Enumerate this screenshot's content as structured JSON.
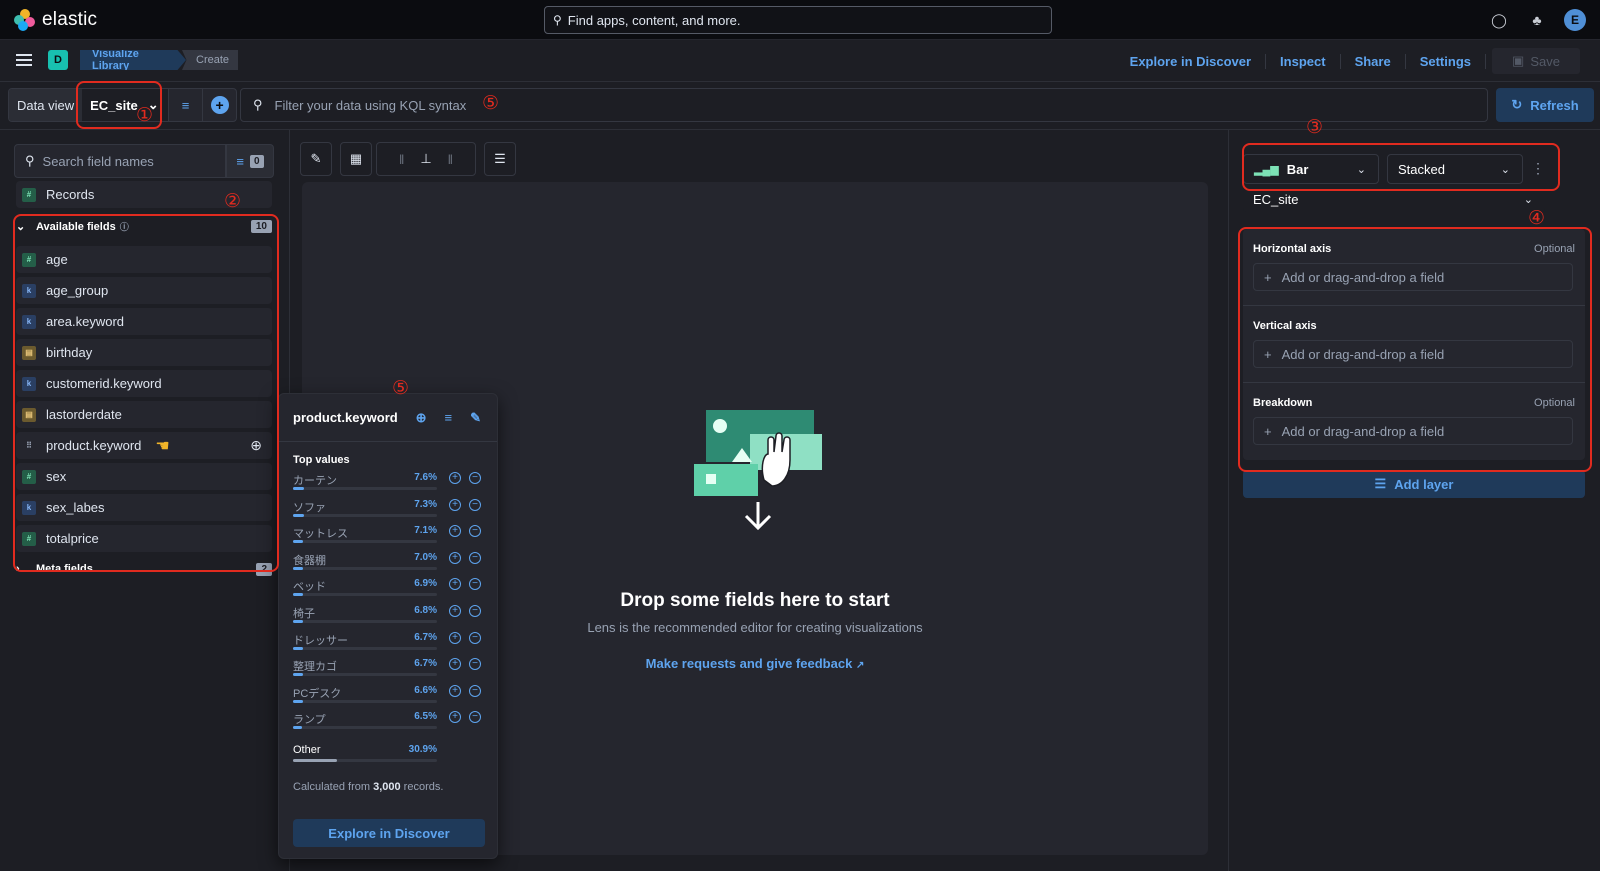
{
  "topbar": {
    "logo_text": "elastic",
    "search_placeholder": "Find apps, content, and more.",
    "avatar_initial": "E"
  },
  "navbar": {
    "space_initial": "D",
    "breadcrumbs": [
      "Visualize Library",
      "Create"
    ],
    "links": [
      "Explore in Discover",
      "Inspect",
      "Share",
      "Settings"
    ],
    "save_label": "Save"
  },
  "querybar": {
    "data_view_label": "Data view",
    "data_view_value": "EC_site",
    "kql_placeholder": "Filter your data using KQL syntax",
    "refresh_label": "Refresh"
  },
  "sidebar": {
    "search_placeholder": "Search field names",
    "filter_count": "0",
    "records_label": "Records",
    "available_label": "Available fields",
    "available_count": "10",
    "fields": [
      {
        "name": "age",
        "type": "number"
      },
      {
        "name": "age_group",
        "type": "keyword"
      },
      {
        "name": "area.keyword",
        "type": "keyword"
      },
      {
        "name": "birthday",
        "type": "date"
      },
      {
        "name": "customerid.keyword",
        "type": "keyword"
      },
      {
        "name": "lastorderdate",
        "type": "date"
      },
      {
        "name": "product.keyword",
        "type": "keyword"
      },
      {
        "name": "sex",
        "type": "number"
      },
      {
        "name": "sex_labes",
        "type": "keyword"
      },
      {
        "name": "totalprice",
        "type": "number"
      }
    ],
    "meta_label": "Meta fields",
    "meta_count": "2"
  },
  "annotations": [
    "①",
    "②",
    "③",
    "④",
    "⑤",
    "⑤"
  ],
  "workspace": {
    "drop_title": "Drop some fields here to start",
    "drop_subtitle": "Lens is the recommended editor for creating visualizations",
    "feedback_link": "Make requests and give feedback"
  },
  "popover": {
    "field_name": "product.keyword",
    "top_values_title": "Top values",
    "values": [
      {
        "label": "カーテン",
        "pct": "7.6%",
        "frac": 0.076
      },
      {
        "label": "ソファ",
        "pct": "7.3%",
        "frac": 0.073
      },
      {
        "label": "マットレス",
        "pct": "7.1%",
        "frac": 0.071
      },
      {
        "label": "食器棚",
        "pct": "7.0%",
        "frac": 0.07
      },
      {
        "label": "ベッド",
        "pct": "6.9%",
        "frac": 0.069
      },
      {
        "label": "椅子",
        "pct": "6.8%",
        "frac": 0.068
      },
      {
        "label": "ドレッサー",
        "pct": "6.7%",
        "frac": 0.067
      },
      {
        "label": "整理カゴ",
        "pct": "6.7%",
        "frac": 0.067
      },
      {
        "label": "PCデスク",
        "pct": "6.6%",
        "frac": 0.066
      },
      {
        "label": "ランプ",
        "pct": "6.5%",
        "frac": 0.065
      }
    ],
    "other_label": "Other",
    "other_pct": "30.9%",
    "other_frac": 0.309,
    "calc_prefix": "Calculated from ",
    "calc_count": "3,000",
    "calc_suffix": " records.",
    "explore_label": "Explore in Discover"
  },
  "config": {
    "chart_type": "Bar",
    "stack_mode": "Stacked",
    "layer_data_view": "EC_site",
    "axes": [
      {
        "label": "Horizontal axis",
        "optional": "Optional",
        "placeholder": "Add or drag-and-drop a field"
      },
      {
        "label": "Vertical axis",
        "optional": "",
        "placeholder": "Add or drag-and-drop a field"
      },
      {
        "label": "Breakdown",
        "optional": "Optional",
        "placeholder": "Add or drag-and-drop a field"
      }
    ],
    "add_layer_label": "Add layer"
  }
}
